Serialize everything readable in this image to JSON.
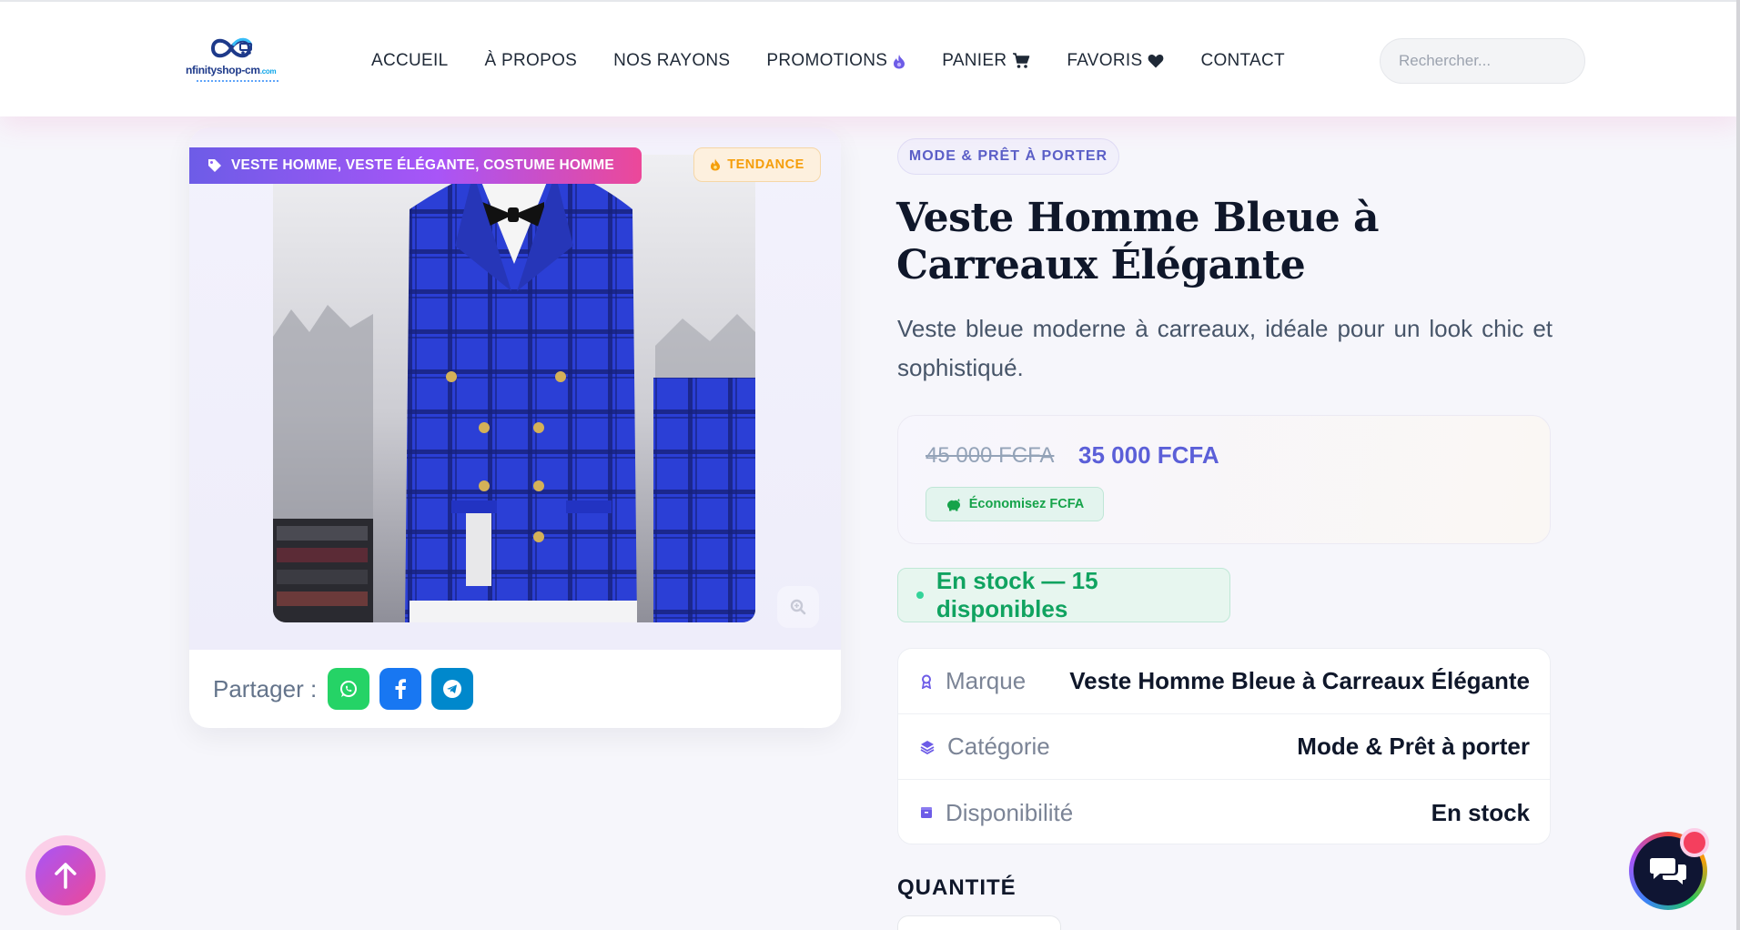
{
  "header": {
    "logo_text": "nfinityshop-cm",
    "logo_suffix": ".com",
    "nav": [
      {
        "label": "ACCUEIL",
        "icon": null
      },
      {
        "label": "À PROPOS",
        "icon": null
      },
      {
        "label": "NOS RAYONS",
        "icon": null
      },
      {
        "label": "PROMOTIONS",
        "icon": "fire-icon"
      },
      {
        "label": "PANIER",
        "icon": "cart-icon"
      },
      {
        "label": "FAVORIS",
        "icon": "heart-icon"
      },
      {
        "label": "CONTACT",
        "icon": null
      }
    ],
    "search": {
      "placeholder": "Rechercher...",
      "value": ""
    }
  },
  "product": {
    "tags_badge": "VESTE HOMME, VESTE ÉLÉGANTE, COSTUME HOMME",
    "trend_badge": "TENDANCE",
    "share_label": "Partager :",
    "share_buttons": [
      {
        "name": "whatsapp",
        "color": "#25d366"
      },
      {
        "name": "facebook",
        "color": "#1877f2"
      },
      {
        "name": "telegram",
        "color": "#0088cc"
      }
    ],
    "category_pill": "MODE & PRÊT À PORTER",
    "title": "Veste Homme Bleue à Carreaux Élégante",
    "description": "Veste bleue moderne à carreaux, idéale pour un look chic et sophistiqué.",
    "old_price": "45 000 FCFA",
    "new_price": "35 000 FCFA",
    "savings": "Économisez FCFA",
    "stock": "En stock — 15 disponibles",
    "specs": [
      {
        "label": "Marque",
        "value": "Veste Homme Bleue à Carreaux Élégante",
        "icon": "award-icon"
      },
      {
        "label": "Catégorie",
        "value": "Mode & Prêt à porter",
        "icon": "layers-icon"
      },
      {
        "label": "Disponibilité",
        "value": "En stock",
        "icon": "box-icon"
      }
    ],
    "quantity_heading": "QUANTITÉ"
  },
  "colors": {
    "accent": "#6d5ce7",
    "accent_pink": "#ec4899",
    "price": "#5b5fd8",
    "success": "#10a360",
    "trend": "#f59e0b"
  }
}
